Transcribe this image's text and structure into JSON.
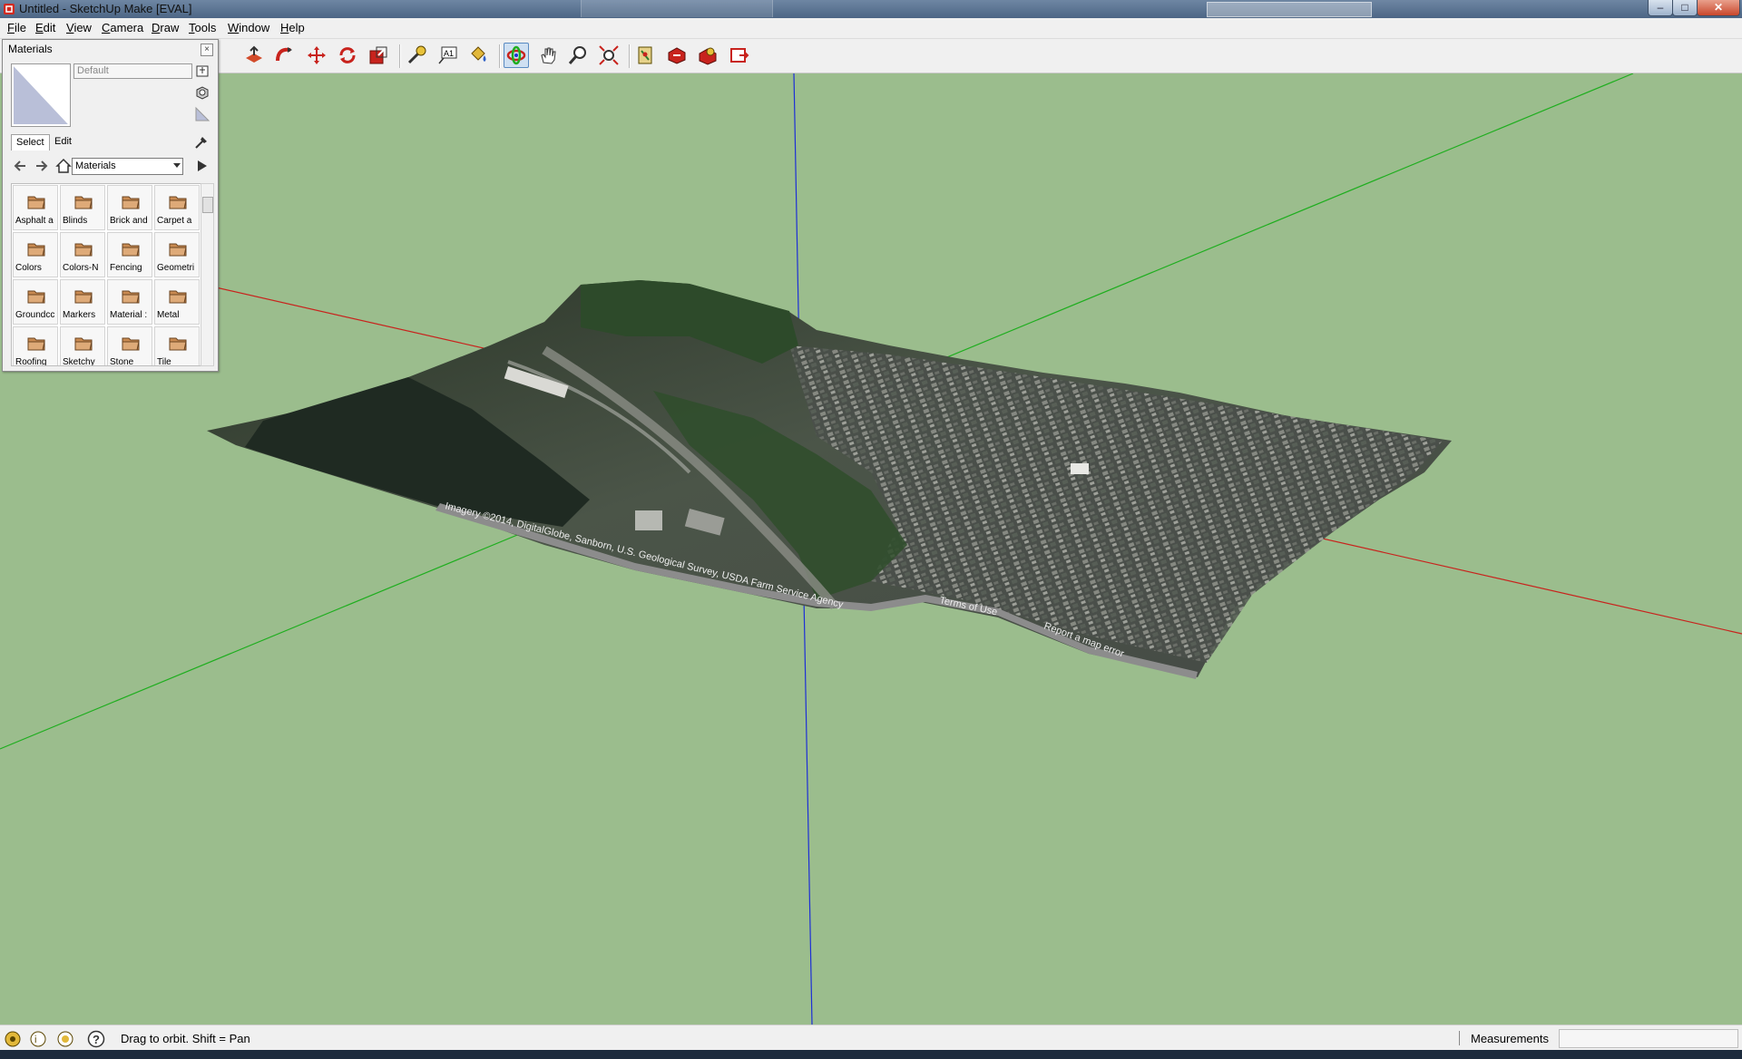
{
  "window": {
    "title": "Untitled - SketchUp Make [EVAL]"
  },
  "menu": [
    "File",
    "Edit",
    "View",
    "Camera",
    "Draw",
    "Tools",
    "Window",
    "Help"
  ],
  "toolbar": {
    "tools": [
      "push-pull",
      "follow-me",
      "move",
      "rotate",
      "scale",
      "tape-measure",
      "text",
      "paint-bucket",
      "orbit",
      "pan",
      "zoom",
      "zoom-extents",
      "add-location",
      "get-models",
      "share-model",
      "send-to-layout"
    ],
    "active_tool": "orbit"
  },
  "materials_panel": {
    "title": "Materials",
    "material_name": "Default",
    "tabs": [
      "Select",
      "Edit"
    ],
    "selected_tab": "Select",
    "library": "Materials",
    "items": [
      "Asphalt a",
      "Blinds",
      "Brick and",
      "Carpet a",
      "Colors",
      "Colors-N",
      "Fencing",
      "Geometri",
      "Groundcc",
      "Markers",
      "Material :",
      "Metal",
      "Roofing",
      "Sketchy",
      "Stone",
      "Tile"
    ]
  },
  "terrain": {
    "attribution": "Imagery ©2014, DigitalGlobe, Sanborn, U.S. Geological Survey, USDA Farm Service Agency",
    "terms": "Terms of Use",
    "report": "Report a map error"
  },
  "statusbar": {
    "hint": "Drag to orbit.  Shift = Pan",
    "measurements_label": "Measurements",
    "measurements_value": ""
  },
  "colors": {
    "background": "#9bbd8d",
    "axis_red": "#c8231d",
    "axis_green": "#1fae1f",
    "axis_blue": "#1d2fd6"
  }
}
